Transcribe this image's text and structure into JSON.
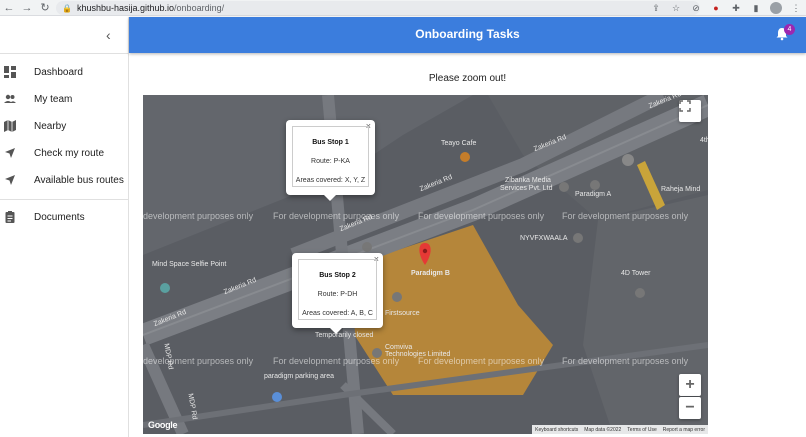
{
  "browser": {
    "url_host": "khushbu-hasija.github.io",
    "url_path": "/onboarding/"
  },
  "sidebar": {
    "items": [
      {
        "label": "Dashboard",
        "icon": "dashboard-icon"
      },
      {
        "label": "My team",
        "icon": "people-icon"
      },
      {
        "label": "Nearby",
        "icon": "map-icon"
      },
      {
        "label": "Check my route",
        "icon": "navigation-icon"
      },
      {
        "label": "Available bus routes",
        "icon": "navigation-icon"
      },
      {
        "label": "Documents",
        "icon": "assignment-icon"
      }
    ]
  },
  "header": {
    "title": "Onboarding Tasks",
    "notification_count": "4",
    "color": "#3b7ddd"
  },
  "main": {
    "zoom_message": "Please zoom out!"
  },
  "map": {
    "watermark": "For development purposes only",
    "watermark_left_partial": "development purposes only",
    "popups": [
      {
        "title": "Bus Stop 1",
        "route": "Route: P-KA",
        "areas": "Areas covered: X, Y, Z"
      },
      {
        "title": "Bus Stop 2",
        "route": "Route: P-DH",
        "areas": "Areas covered: A, B, C"
      }
    ],
    "labels": {
      "teayo": "Teayo Cafe",
      "zakeria1": "Zakeria Rd",
      "zakeria2": "Zakeria Rd",
      "zakeria3": "Zakeria Rd",
      "zakeria4": "Zakeria Rd",
      "zibanka": "Zibanka Media",
      "zibanka2": "Services Pvt. Ltd",
      "paradigm_a": "Paradigm A",
      "raheja": "Raheja Mind",
      "nyvf": "NYVFXWAALA",
      "mindspace": "Mind Space Selfie Point",
      "paradigm_b": "Paradigm B",
      "tower": "4D Tower",
      "firstsource": "Firstsource",
      "comviva": "Comviva",
      "comviva2": "Technologies Limited",
      "parking": "paradigm parking area",
      "mdp": "MDP Rd",
      "mdp2": "MDP Rd",
      "temp": "Temporarily closed",
      "fourth": "4th"
    },
    "footer": {
      "shortcuts": "Keyboard shortcuts",
      "data": "Map data ©2022",
      "terms": "Terms of Use",
      "report": "Report a map error"
    },
    "brand": "Google",
    "zoom_in": "+",
    "zoom_out": "−"
  }
}
